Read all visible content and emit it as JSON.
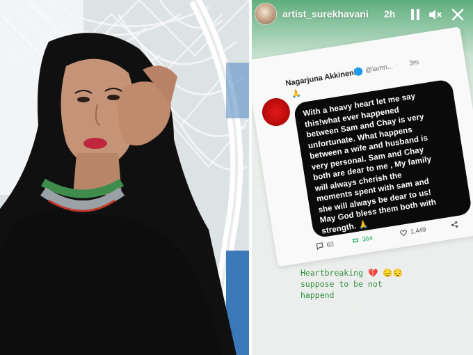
{
  "story": {
    "username": "artist_surekhavani",
    "time": "2h",
    "tweet": {
      "name": "Nagarjuna Akkineni",
      "handle": "@iamn...",
      "timestamp": "3m",
      "emoji": "🙏",
      "lines": [
        "With a heavy heart let me say",
        "this!what ever happened",
        "between Sam and Chay is very",
        "unfortunate. What happens",
        "between a wife and husband is",
        "very personal. Sam and Chay",
        "both are  dear to me , My family",
        "will always cherish the",
        "moments spent with sam and",
        "she will always be dear to us!",
        "May God bless them both with",
        "strength. 🙏"
      ],
      "replies": "63",
      "retweets": "364",
      "likes": "1,449"
    },
    "caption": {
      "line1": "Heartbreaking",
      "heart": "💔",
      "sad": "😔😔",
      "line2": "suppose to be not",
      "line3": "happend"
    }
  },
  "icons": {
    "pause": "pause-icon",
    "mute": "mute-icon",
    "close": "close-icon",
    "verified": "verified-icon",
    "reply": "reply-icon",
    "retweet": "retweet-icon",
    "like": "heart-icon",
    "share": "share-icon"
  },
  "colors": {
    "caption": "#2f8a3a",
    "tweet_bubble": "#0a0a0a",
    "retweet": "#17a561",
    "verified": "#1d9bf0"
  }
}
